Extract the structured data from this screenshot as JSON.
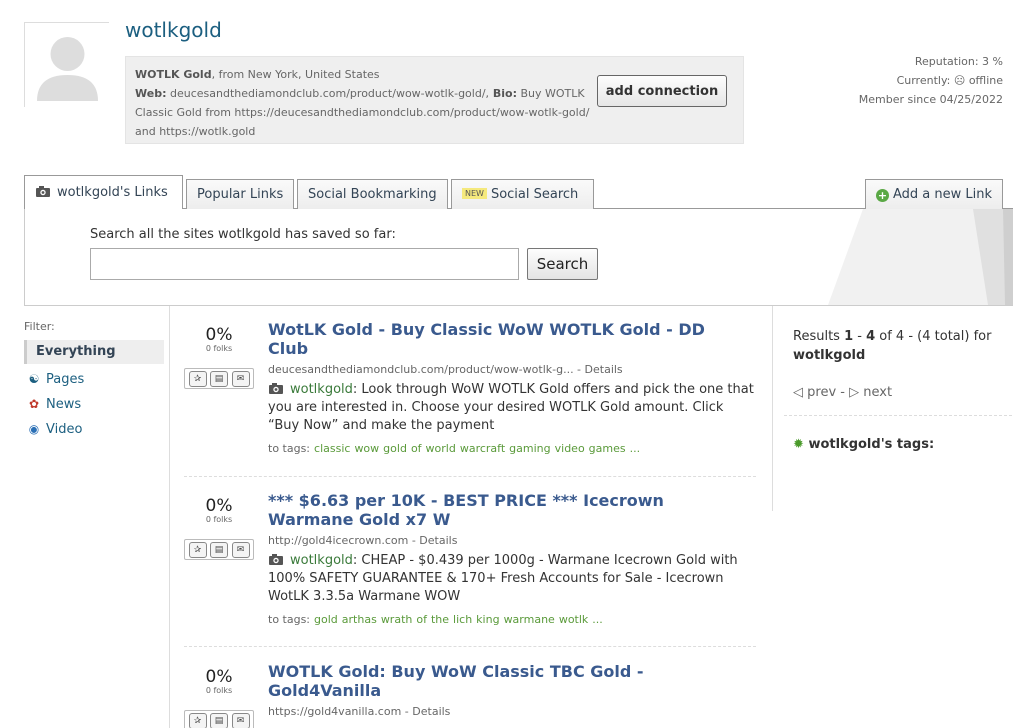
{
  "profile": {
    "username": "wotlkgold",
    "bio_name": "WOTLK Gold",
    "bio_from": ", from New York, United States",
    "web_label": "Web:",
    "web_value": " deucesandthediamondclub.com/product/wow-wotlk-gold/,",
    "bio_label": " Bio:",
    "bio_value": " Buy WOTLK Classic Gold from https://deucesandthediamondclub.com/product/wow-wotlk-gold/ and https://wotlk.gold",
    "add_connection": "add connection",
    "reputation": "Reputation: 3 %",
    "currently": "Currently: ☹ offline",
    "member_since": "Member since 04/25/2022"
  },
  "tabs": {
    "links": "wotlkgold's Links",
    "popular": "Popular Links",
    "social_bookmarking": "Social Bookmarking",
    "new_badge": "NEW",
    "social_search": "Social Search",
    "add_link": "Add a new Link"
  },
  "search": {
    "label": "Search all the sites wotlkgold has saved so far:",
    "value": "",
    "button": "Search"
  },
  "filter": {
    "label": "Filter:",
    "items": [
      {
        "label": "Everything"
      },
      {
        "label": "Pages",
        "icon": "users-icon"
      },
      {
        "label": "News",
        "icon": "news-icon"
      },
      {
        "label": "Video",
        "icon": "video-icon"
      }
    ]
  },
  "items": [
    {
      "pct": "0%",
      "folks": "0 folks",
      "title": "WotLK Gold - Buy Classic WoW WOTLK Gold - DD Club",
      "url": "deucesandthediamondclub.com/product/wow-wotlk-g...",
      "details": " - Details",
      "user": "wotlkgold",
      "desc": ": Look through WoW WOTLK Gold offers and pick the one that you are interested in. Choose your desired WOTLK Gold amount. Click “Buy Now” and make the payment",
      "tags_label": "to tags:",
      "tags": [
        "classic",
        "wow",
        "gold",
        "of",
        "world",
        "warcraft",
        "gaming",
        "video",
        "games",
        "..."
      ]
    },
    {
      "pct": "0%",
      "folks": "0 folks",
      "title": "*** $6.63 per 10K - BEST PRICE *** Icecrown Warmane Gold x7 W",
      "url": "http://gold4icecrown.com",
      "details": " - Details",
      "user": "wotlkgold",
      "desc": ": CHEAP - $0.439 per 1000g - Warmane Icecrown Gold with 100% SAFETY GUARANTEE & 170+ Fresh Accounts for Sale - Icecrown WotLK 3.3.5a Warmane WOW",
      "tags_label": "to tags:",
      "tags": [
        "gold",
        "arthas",
        "wrath",
        "of",
        "the",
        "lich",
        "king",
        "warmane",
        "wotlk",
        "..."
      ]
    },
    {
      "pct": "0%",
      "folks": "0 folks",
      "title": "WOTLK Gold: Buy WoW Classic TBC Gold - Gold4Vanilla",
      "url": "https://gold4vanilla.com",
      "details": " - Details"
    }
  ],
  "results": {
    "prefix": "Results ",
    "from": "1",
    "dash": " - ",
    "to": "4",
    "of": " of 4 - (4 total) for",
    "query": "wotlkgold",
    "prev": "prev",
    "sep": " - ",
    "next": "next",
    "tags_heading": "wotlkgold's tags:"
  }
}
